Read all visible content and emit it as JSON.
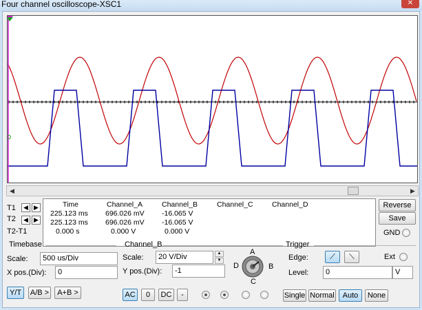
{
  "window": {
    "title": "Four channel oscilloscope-XSC1",
    "close_glyph": "✕"
  },
  "colors": {
    "screen": "#000000",
    "grid": "#ffffff",
    "channel_a": "#c00000",
    "channel_b": "#0000a0",
    "cursor_t1": "#d020d0",
    "cursor_t2": "#20a020"
  },
  "readout": {
    "headers": [
      "Time",
      "Channel_A",
      "Channel_B",
      "Channel_C",
      "Channel_D"
    ],
    "rows": [
      {
        "label": "T1",
        "time": "225.123 ms",
        "a": "696.026 mV",
        "b": "-16.065 V",
        "c": "",
        "d": ""
      },
      {
        "label": "T2",
        "time": "225.123 ms",
        "a": "696.026 mV",
        "b": "-16.065 V",
        "c": "",
        "d": ""
      },
      {
        "label": "T2-T1",
        "time": "0.000 s",
        "a": "0.000 V",
        "b": "0.000 V",
        "c": "",
        "d": ""
      }
    ],
    "left_arrow": "◀",
    "right_arrow": "▶"
  },
  "buttons": {
    "reverse": "Reverse",
    "save": "Save",
    "gnd": "GND"
  },
  "timebase": {
    "title": "Timebase",
    "scale_label": "Scale:",
    "scale_value": "500 us/Div",
    "xpos_label": "X pos.(Div):",
    "xpos_value": "0",
    "mode_yt": "Y/T",
    "mode_ab": "A/B >",
    "mode_apb": "A+B >"
  },
  "channel": {
    "title": "Channel_B",
    "scale_label": "Scale:",
    "scale_value": "20  V/Div",
    "ypos_label": "Y pos.(Div):",
    "ypos_value": "-1",
    "coupling_ac": "AC",
    "coupling_0": "0",
    "coupling_dc": "DC",
    "invert": "-"
  },
  "knob": {
    "a": "A",
    "b": "B",
    "c": "C",
    "d": "D"
  },
  "trigger": {
    "title": "Trigger",
    "edge_label": "Edge:",
    "ext_label": "Ext",
    "level_label": "Level:",
    "level_value": "0",
    "level_unit": "V",
    "single": "Single",
    "normal": "Normal",
    "auto": "Auto",
    "none": "None"
  }
}
